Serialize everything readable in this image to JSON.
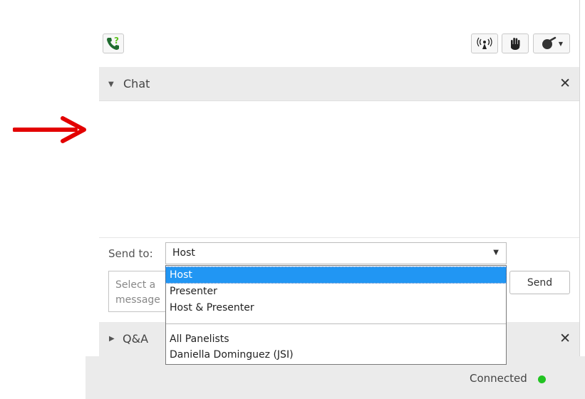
{
  "chat": {
    "title": "Chat",
    "close": "✕"
  },
  "send_to": {
    "label": "Send to:",
    "selected": "Host",
    "options": [
      "Host",
      "Presenter",
      "Host & Presenter",
      "All Panelists",
      "Daniella Dominguez (JSI)"
    ]
  },
  "message": {
    "placeholder_lines": [
      "Select a",
      "message"
    ]
  },
  "send_button": "Send",
  "qa": {
    "title": "Q&A",
    "close": "✕"
  },
  "status": {
    "text": "Connected",
    "color": "#22c322"
  },
  "colors": {
    "arrow": "#e30000",
    "highlight": "#2196f3",
    "phone_icon": "#1f6b2f",
    "question_mark": "#5cc21f"
  },
  "icons": [
    "phone-help-icon",
    "broadcast-icon",
    "raise-hand-icon",
    "emoticon-icon"
  ]
}
